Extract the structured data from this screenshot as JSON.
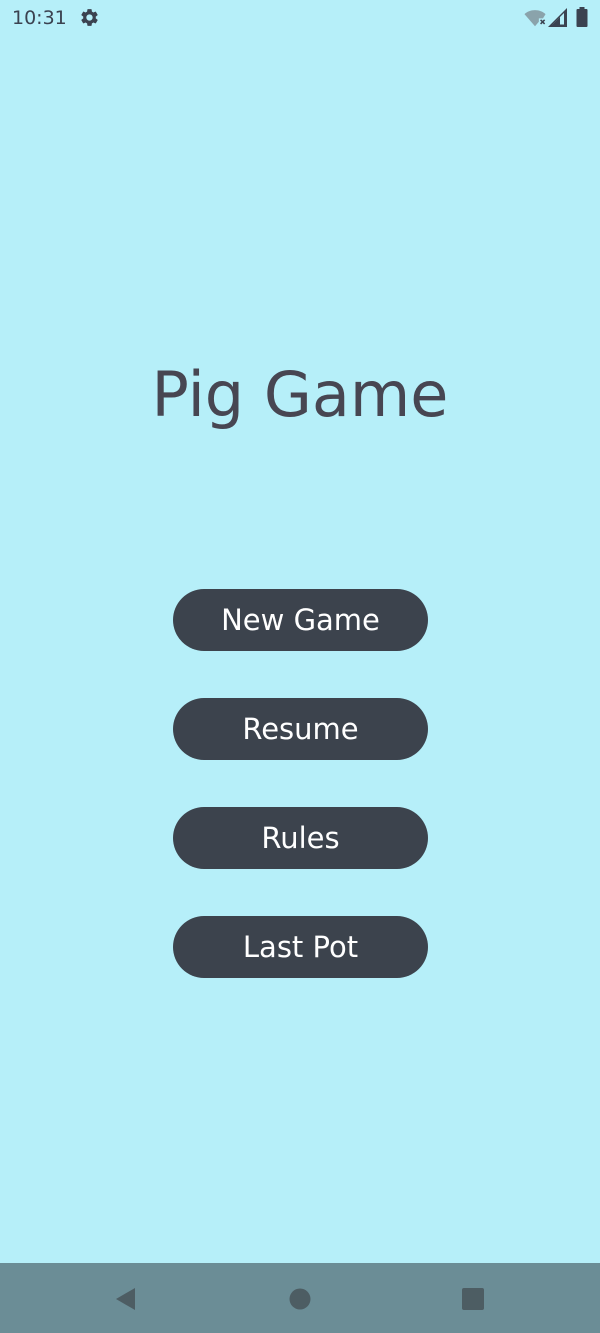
{
  "status_bar": {
    "time": "10:31",
    "icons": [
      "gear-icon",
      "wifi-off-icon",
      "cell-signal-icon",
      "battery-icon"
    ]
  },
  "app": {
    "title": "Pig Game"
  },
  "menu": {
    "new_game_label": "New Game",
    "resume_label": "Resume",
    "rules_label": "Rules",
    "last_pot_label": "Last Pot"
  },
  "nav_bar": {
    "icons": [
      "back-icon",
      "home-icon",
      "recents-icon"
    ]
  },
  "colors": {
    "background": "#b6eff9",
    "button": "#3c434d",
    "button_text": "#ffffff",
    "title_text": "#474652",
    "nav_bar": "#6b8d96"
  }
}
